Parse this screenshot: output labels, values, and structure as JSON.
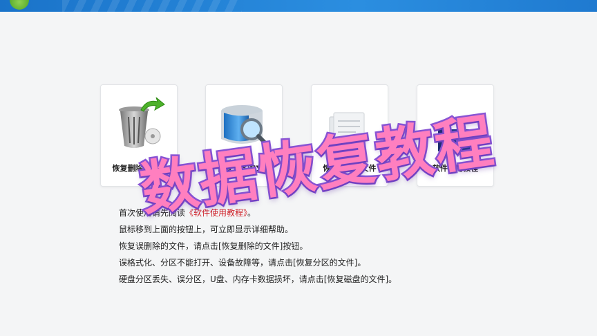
{
  "cards": [
    {
      "id": "recover-deleted",
      "label": "恢复删除的文件",
      "icon": "trash-restore-icon"
    },
    {
      "id": "recover-partition",
      "label": "恢复分区的文件",
      "icon": "disk-search-icon"
    },
    {
      "id": "recover-disk",
      "label": "恢复磁盘的文件",
      "icon": "document-stack-icon"
    },
    {
      "id": "tutorial",
      "label": "软件使用教程",
      "icon": "tutorial-book-icon"
    }
  ],
  "help": {
    "line1_prefix": "首次使用请先阅读",
    "line1_link": "《软件使用教程》",
    "line1_suffix": "。",
    "line2": "鼠标移到上面的按钮上，可立即显示详细帮助。",
    "line3": "恢复误删除的文件，请点击[恢复删除的文件]按钮。",
    "line4": "误格式化、分区不能打开、设备故障等，请点击[恢复分区的文件]。",
    "line5": "硬盘分区丢失、误分区，U盘、内存卡数据损坏，请点击[恢复磁盘的文件]。"
  },
  "watermark": {
    "text": "数据恢复教程"
  },
  "colors": {
    "titlebar": "#1f7ad0",
    "link": "#d0242b",
    "watermark_fill": "#ff7fbf",
    "watermark_stroke": "#8a56d6"
  }
}
